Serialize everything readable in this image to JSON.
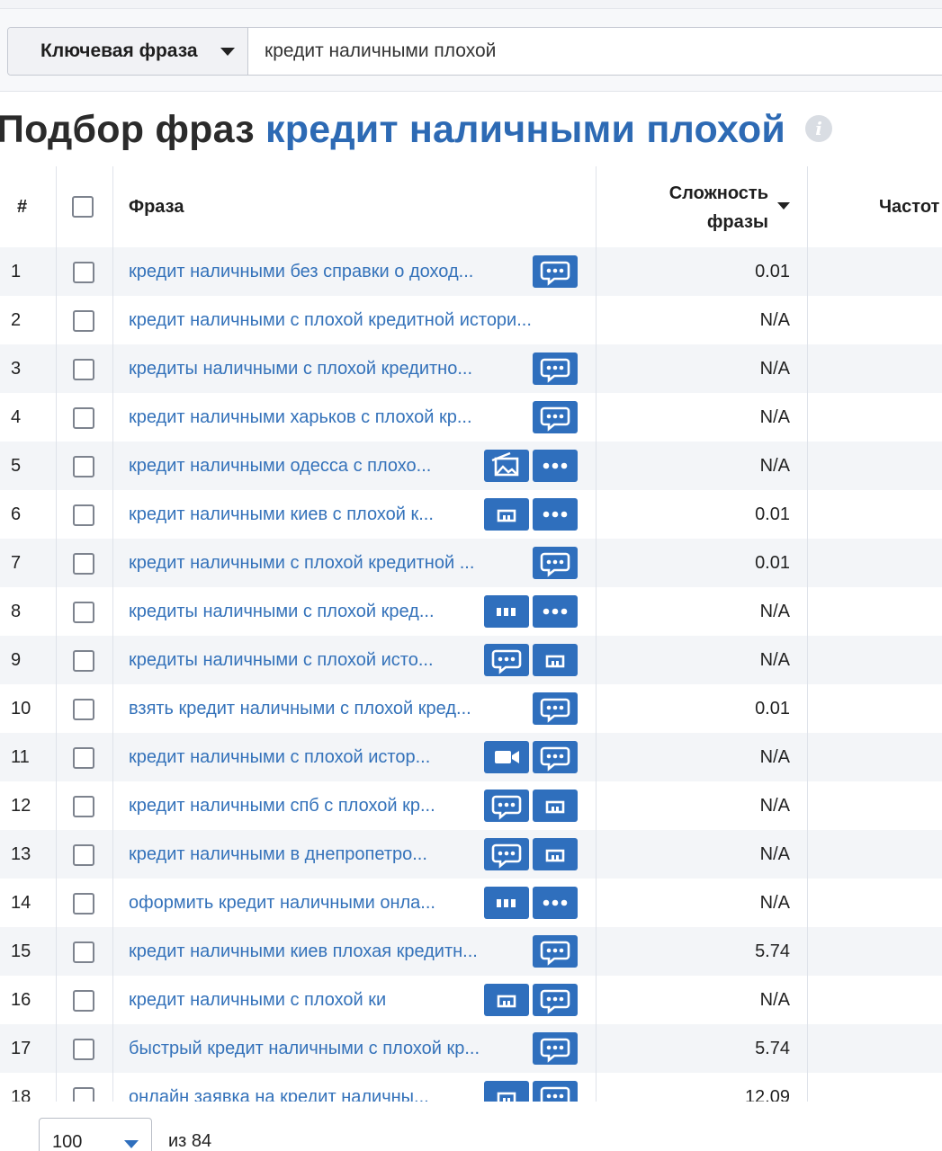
{
  "search": {
    "type_label": "Ключевая фраза",
    "query": "кредит наличными плохой"
  },
  "title": {
    "prefix": "Подбор фраз",
    "keyword": "кредит наличными плохой"
  },
  "columns": {
    "num": "#",
    "phrase": "Фраза",
    "difficulty_line1": "Сложность",
    "difficulty_line2": "фразы",
    "frequency": "Частот"
  },
  "colors": {
    "accent": "#2f6fbd",
    "link": "#3472ba"
  },
  "rows": [
    {
      "num": "1",
      "phrase": "кредит наличными без справки о доход...",
      "difficulty": "0.01",
      "features": [
        "chat-icon"
      ]
    },
    {
      "num": "2",
      "phrase": "кредит наличными с плохой кредитной истори...",
      "difficulty": "N/A",
      "features": []
    },
    {
      "num": "3",
      "phrase": "кредиты наличными с плохой кредитно...",
      "difficulty": "N/A",
      "features": [
        "chat-icon"
      ]
    },
    {
      "num": "4",
      "phrase": "кредит наличными харьков с плохой кр...",
      "difficulty": "N/A",
      "features": [
        "chat-icon"
      ]
    },
    {
      "num": "5",
      "phrase": "кредит наличными одесса с плохо...",
      "difficulty": "N/A",
      "features": [
        "image-icon",
        "more-icon"
      ]
    },
    {
      "num": "6",
      "phrase": "кредит наличными киев с плохой к...",
      "difficulty": "0.01",
      "features": [
        "shop-icon",
        "more-icon"
      ]
    },
    {
      "num": "7",
      "phrase": "кредит наличными с плохой кредитной ...",
      "difficulty": "0.01",
      "features": [
        "chat-icon"
      ]
    },
    {
      "num": "8",
      "phrase": "кредиты наличными с плохой кред...",
      "difficulty": "N/A",
      "features": [
        "sitelinks-icon",
        "more-icon"
      ]
    },
    {
      "num": "9",
      "phrase": "кредиты наличными с плохой исто...",
      "difficulty": "N/A",
      "features": [
        "chat-icon",
        "shop-icon"
      ]
    },
    {
      "num": "10",
      "phrase": "взять кредит наличными с плохой кред...",
      "difficulty": "0.01",
      "features": [
        "chat-icon"
      ]
    },
    {
      "num": "11",
      "phrase": "кредит наличными с плохой истор...",
      "difficulty": "N/A",
      "features": [
        "video-icon",
        "chat-icon"
      ]
    },
    {
      "num": "12",
      "phrase": "кредит наличными спб с плохой кр...",
      "difficulty": "N/A",
      "features": [
        "chat-icon",
        "shop-icon"
      ]
    },
    {
      "num": "13",
      "phrase": "кредит наличными в днепропетро...",
      "difficulty": "N/A",
      "features": [
        "chat-icon",
        "shop-icon"
      ]
    },
    {
      "num": "14",
      "phrase": "оформить кредит наличными онла...",
      "difficulty": "N/A",
      "features": [
        "sitelinks-icon",
        "more-icon"
      ]
    },
    {
      "num": "15",
      "phrase": "кредит наличными киев плохая кредитн...",
      "difficulty": "5.74",
      "features": [
        "chat-icon"
      ]
    },
    {
      "num": "16",
      "phrase": "кредит наличными с плохой ки",
      "difficulty": "N/A",
      "features": [
        "shop-icon",
        "chat-icon"
      ]
    },
    {
      "num": "17",
      "phrase": "быстрый кредит наличными с плохой кр...",
      "difficulty": "5.74",
      "features": [
        "chat-icon"
      ]
    },
    {
      "num": "18",
      "phrase": "онлайн заявка на кредит наличны...",
      "difficulty": "12.09",
      "features": [
        "shop-icon",
        "chat-icon"
      ]
    }
  ],
  "pagination": {
    "per_page": "100",
    "total_label": "из 84"
  }
}
